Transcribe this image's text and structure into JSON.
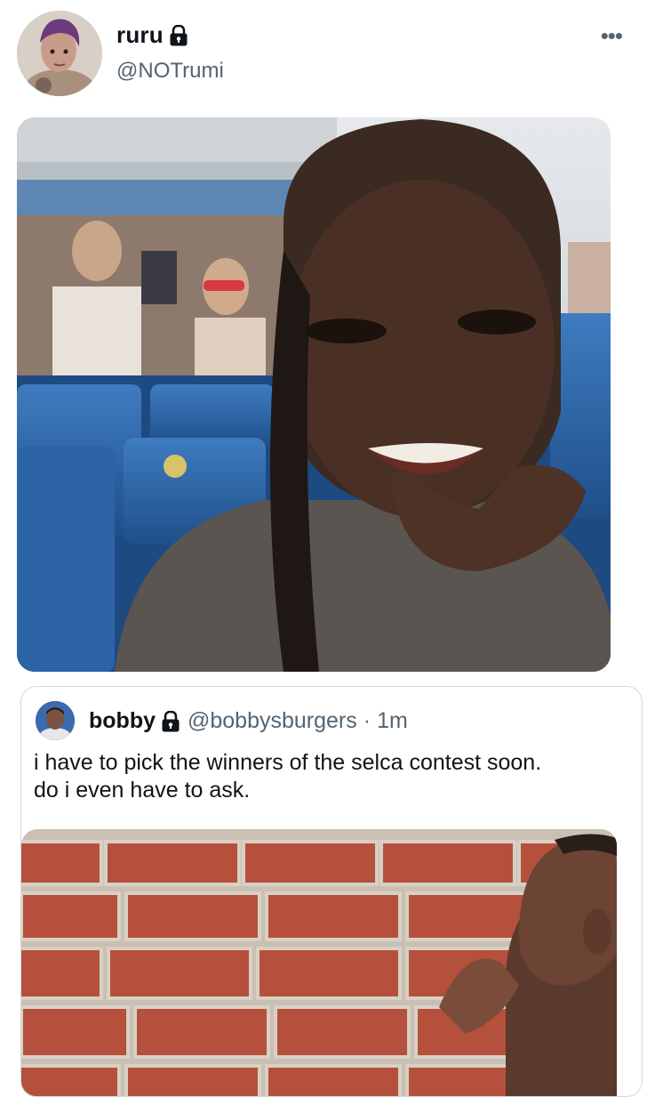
{
  "tweet": {
    "display_name": "ruru",
    "handle": "@NOTrumi",
    "more_label": "•••"
  },
  "quoted": {
    "display_name": "bobby",
    "handle": "@bobbysburgers",
    "separator": "·",
    "time": "1m",
    "text_line1": "i have to pick the winners of the selca contest soon.",
    "text_line2": "do i even have to ask."
  },
  "icons": {
    "protected": "lock-icon",
    "more": "more-options-icon"
  },
  "colors": {
    "text_primary": "#0f1419",
    "text_secondary": "#536471",
    "border": "#cfd9de",
    "seat_blue": "#2f6fb5",
    "brick": "#b5503c"
  }
}
